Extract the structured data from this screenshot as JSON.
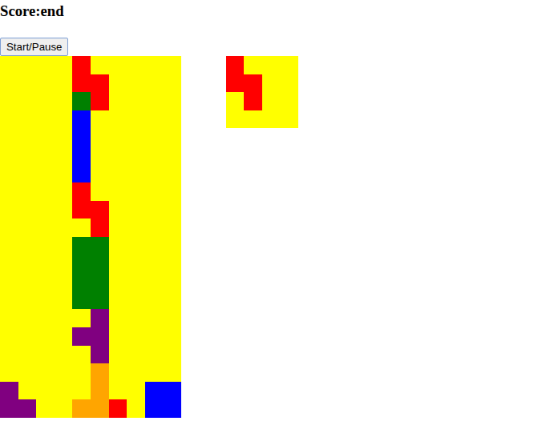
{
  "score": {
    "text": "Score:end"
  },
  "button": {
    "label": "Start/Pause"
  },
  "board": {
    "rows": [
      [
        "#ffff00",
        "#ffff00",
        "#ffff00",
        "#ffff00",
        "#ff0000",
        "#ffff00",
        "#ffff00",
        "#ffff00",
        "#ffff00",
        "#ffff00"
      ],
      [
        "#ffff00",
        "#ffff00",
        "#ffff00",
        "#ffff00",
        "#ff0000",
        "#ff0000",
        "#ffff00",
        "#ffff00",
        "#ffff00",
        "#ffff00"
      ],
      [
        "#ffff00",
        "#ffff00",
        "#ffff00",
        "#ffff00",
        "#008000",
        "#ff0000",
        "#ffff00",
        "#ffff00",
        "#ffff00",
        "#ffff00"
      ],
      [
        "#ffff00",
        "#ffff00",
        "#ffff00",
        "#ffff00",
        "#0000ff",
        "#ffff00",
        "#ffff00",
        "#ffff00",
        "#ffff00",
        "#ffff00"
      ],
      [
        "#ffff00",
        "#ffff00",
        "#ffff00",
        "#ffff00",
        "#0000ff",
        "#ffff00",
        "#ffff00",
        "#ffff00",
        "#ffff00",
        "#ffff00"
      ],
      [
        "#ffff00",
        "#ffff00",
        "#ffff00",
        "#ffff00",
        "#0000ff",
        "#ffff00",
        "#ffff00",
        "#ffff00",
        "#ffff00",
        "#ffff00"
      ],
      [
        "#ffff00",
        "#ffff00",
        "#ffff00",
        "#ffff00",
        "#0000ff",
        "#ffff00",
        "#ffff00",
        "#ffff00",
        "#ffff00",
        "#ffff00"
      ],
      [
        "#ffff00",
        "#ffff00",
        "#ffff00",
        "#ffff00",
        "#ff0000",
        "#ffff00",
        "#ffff00",
        "#ffff00",
        "#ffff00",
        "#ffff00"
      ],
      [
        "#ffff00",
        "#ffff00",
        "#ffff00",
        "#ffff00",
        "#ff0000",
        "#ff0000",
        "#ffff00",
        "#ffff00",
        "#ffff00",
        "#ffff00"
      ],
      [
        "#ffff00",
        "#ffff00",
        "#ffff00",
        "#ffff00",
        "#ffff00",
        "#ff0000",
        "#ffff00",
        "#ffff00",
        "#ffff00",
        "#ffff00"
      ],
      [
        "#ffff00",
        "#ffff00",
        "#ffff00",
        "#ffff00",
        "#008000",
        "#008000",
        "#ffff00",
        "#ffff00",
        "#ffff00",
        "#ffff00"
      ],
      [
        "#ffff00",
        "#ffff00",
        "#ffff00",
        "#ffff00",
        "#008000",
        "#008000",
        "#ffff00",
        "#ffff00",
        "#ffff00",
        "#ffff00"
      ],
      [
        "#ffff00",
        "#ffff00",
        "#ffff00",
        "#ffff00",
        "#008000",
        "#008000",
        "#ffff00",
        "#ffff00",
        "#ffff00",
        "#ffff00"
      ],
      [
        "#ffff00",
        "#ffff00",
        "#ffff00",
        "#ffff00",
        "#008000",
        "#008000",
        "#ffff00",
        "#ffff00",
        "#ffff00",
        "#ffff00"
      ],
      [
        "#ffff00",
        "#ffff00",
        "#ffff00",
        "#ffff00",
        "#ffff00",
        "#800080",
        "#ffff00",
        "#ffff00",
        "#ffff00",
        "#ffff00"
      ],
      [
        "#ffff00",
        "#ffff00",
        "#ffff00",
        "#ffff00",
        "#800080",
        "#800080",
        "#ffff00",
        "#ffff00",
        "#ffff00",
        "#ffff00"
      ],
      [
        "#ffff00",
        "#ffff00",
        "#ffff00",
        "#ffff00",
        "#ffff00",
        "#800080",
        "#ffff00",
        "#ffff00",
        "#ffff00",
        "#ffff00"
      ],
      [
        "#ffff00",
        "#ffff00",
        "#ffff00",
        "#ffff00",
        "#ffff00",
        "#ffa500",
        "#ffff00",
        "#ffff00",
        "#ffff00",
        "#ffff00"
      ],
      [
        "#800080",
        "#ffff00",
        "#ffff00",
        "#ffff00",
        "#ffff00",
        "#ffa500",
        "#ffff00",
        "#ffff00",
        "#0000ff",
        "#0000ff"
      ],
      [
        "#800080",
        "#800080",
        "#ffff00",
        "#ffff00",
        "#ffa500",
        "#ffa500",
        "#ff0000",
        "#ffff00",
        "#0000ff",
        "#0000ff"
      ]
    ]
  },
  "next_piece": {
    "rows": [
      [
        "#ff0000",
        "#ffff00",
        "#ffff00",
        "#ffff00"
      ],
      [
        "#ff0000",
        "#ff0000",
        "#ffff00",
        "#ffff00"
      ],
      [
        "#ffff00",
        "#ff0000",
        "#ffff00",
        "#ffff00"
      ],
      [
        "#ffff00",
        "#ffff00",
        "#ffff00",
        "#ffff00"
      ]
    ]
  }
}
